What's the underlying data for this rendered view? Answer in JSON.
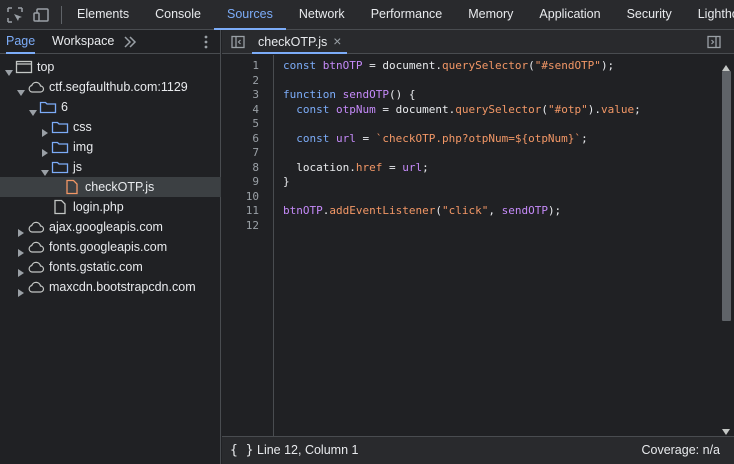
{
  "toolbar": {
    "tabs": [
      {
        "label": "Elements"
      },
      {
        "label": "Console"
      },
      {
        "label": "Sources"
      },
      {
        "label": "Network"
      },
      {
        "label": "Performance"
      },
      {
        "label": "Memory"
      },
      {
        "label": "Application"
      },
      {
        "label": "Security"
      },
      {
        "label": "Lighthouse"
      }
    ],
    "active_tab": "Sources",
    "icons": [
      "inspect-element-icon",
      "device-toolbar-icon"
    ]
  },
  "navigator": {
    "subtabs": [
      {
        "label": "Page"
      },
      {
        "label": "Workspace"
      }
    ],
    "more_icon": "chevron-double-right-icon",
    "menu_icon": "kebab-menu-icon",
    "tree": [
      {
        "label": "top"
      },
      {
        "label": "ctf.segfaulthub.com:1129"
      },
      {
        "label": "6"
      },
      {
        "label": "css"
      },
      {
        "label": "img"
      },
      {
        "label": "js"
      },
      {
        "label": "checkOTP.js"
      },
      {
        "label": "login.php"
      },
      {
        "label": "ajax.googleapis.com"
      },
      {
        "label": "fonts.googleapis.com"
      },
      {
        "label": "fonts.gstatic.com"
      },
      {
        "label": "maxcdn.bootstrapcdn.com"
      }
    ]
  },
  "editor": {
    "file_tab": "checkOTP.js",
    "close_glyph": "×",
    "line_numbers": [
      "1",
      "2",
      "3",
      "4",
      "5",
      "6",
      "7",
      "8",
      "9",
      "10",
      "11",
      "12"
    ],
    "code_lines": [
      "const btnOTP = document.querySelector(\"#sendOTP\");",
      "",
      "function sendOTP() {",
      "  const otpNum = document.querySelector(\"#otp\").value;",
      "",
      "  const url = `checkOTP.php?otpNum=${otpNum}`;",
      "",
      "  location.href = url;",
      "}",
      "",
      "btnOTP.addEventListener(\"click\", sendOTP);",
      ""
    ],
    "status": {
      "braces": "{ }",
      "position": "Line 12, Column 1",
      "coverage": "Coverage: n/a"
    }
  },
  "colors": {
    "accent": "#7cacf8",
    "folder": "#7cacf8",
    "js_file": "#f29766",
    "keyword": "#7cacf8",
    "variable": "#c58af9",
    "string": "#f29766"
  }
}
